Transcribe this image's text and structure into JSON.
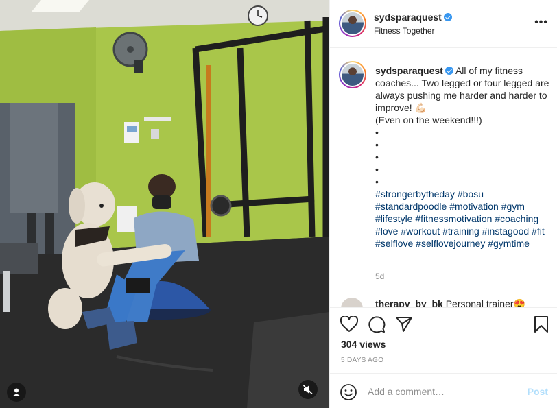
{
  "post": {
    "username": "sydsparaquest",
    "location": "Fitness Together",
    "more_label": "•••"
  },
  "caption": {
    "username": "sydsparaquest",
    "text_line1": "All of my fitness coaches... Two legged or four legged are always pushing me harder and harder to improve! 💪🏻",
    "text_line2": "(Even on the weekend!!!)",
    "bullets": [
      "•",
      "•",
      "•",
      "•",
      "•"
    ],
    "hashtags": [
      "#strongerbytheday",
      "#bosu",
      "#standardpoodle",
      "#motivation",
      "#gym",
      "#lifestyle",
      "#fitnessmotivation",
      "#coaching",
      "#love",
      "#workout",
      "#training",
      "#instagood",
      "#fit",
      "#selflove",
      "#selflovejourney",
      "#gymtime"
    ],
    "time": "5d"
  },
  "comment2": {
    "username": "therapy_by_bk",
    "text": "Personal trainer😍"
  },
  "stats": {
    "views": "304 views",
    "posted_ago": "5 DAYS AGO"
  },
  "composer": {
    "placeholder": "Add a comment…",
    "post_label": "Post"
  },
  "icons": {
    "tag": "user-tag-icon",
    "mute": "speaker-muted-icon",
    "like": "heart-icon",
    "comment": "comment-bubble-icon",
    "share": "paper-plane-icon",
    "save": "bookmark-icon",
    "emoji": "smiley-icon"
  },
  "colors": {
    "verified": "#3897f0",
    "hashtag": "#00376b",
    "post_button_disabled": "#b2dffc",
    "wall": "#a9c64a"
  }
}
